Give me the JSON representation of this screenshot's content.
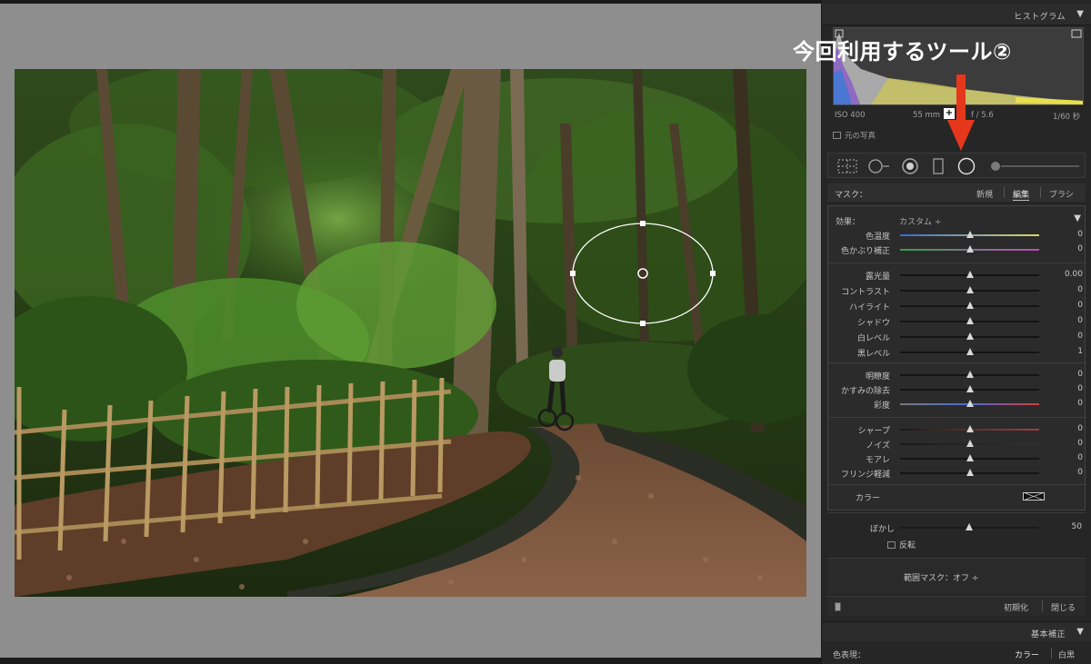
{
  "annotation": {
    "label": "今回利用するツール②",
    "arrow_color": "#e5371c"
  },
  "histogram_panel": {
    "title": "ヒストグラム",
    "iso": "ISO 400",
    "focal": "55 mm",
    "aperture": "f / 5.6",
    "shutter": "1/60 秒",
    "original_photo": "元の写真"
  },
  "tools": [
    "crop-overlay-icon",
    "spot-removal-icon",
    "red-eye-icon",
    "graduated-filter-icon",
    "radial-filter-icon",
    "adjustment-brush-icon"
  ],
  "mask": {
    "label": "マスク：",
    "options": [
      "新規",
      "編集",
      "ブラシ"
    ]
  },
  "effect": {
    "label": "効果：",
    "preset": "カスタム ÷"
  },
  "sliders_wb": [
    {
      "label": "色温度",
      "value": "0",
      "pos": 0.5
    },
    {
      "label": "色かぶり補正",
      "value": "0",
      "pos": 0.5
    }
  ],
  "sliders_tone": [
    {
      "label": "露光量",
      "value": "0.00",
      "pos": 0.5
    },
    {
      "label": "コントラスト",
      "value": "0",
      "pos": 0.5
    },
    {
      "label": "ハイライト",
      "value": "0",
      "pos": 0.5
    },
    {
      "label": "シャドウ",
      "value": "0",
      "pos": 0.5
    },
    {
      "label": "白レベル",
      "value": "0",
      "pos": 0.5
    },
    {
      "label": "黒レベル",
      "value": "1",
      "pos": 0.5
    }
  ],
  "sliders_presence": [
    {
      "label": "明瞭度",
      "value": "0",
      "pos": 0.5
    },
    {
      "label": "かすみの除去",
      "value": "0",
      "pos": 0.5
    },
    {
      "label": "彩度",
      "value": "0",
      "pos": 0.5
    }
  ],
  "sliders_detail": [
    {
      "label": "シャープ",
      "value": "0",
      "pos": 0.5
    },
    {
      "label": "ノイズ",
      "value": "0",
      "pos": 0.5
    },
    {
      "label": "モアレ",
      "value": "0",
      "pos": 0.5
    },
    {
      "label": "フリンジ軽減",
      "value": "0",
      "pos": 0.5
    }
  ],
  "color": {
    "label": "カラー"
  },
  "blur": {
    "label": "ぼかし",
    "value": "50",
    "pos": 0.5
  },
  "invert": {
    "label": "反転"
  },
  "range_mask": {
    "label": "範囲マスク：オフ ÷"
  },
  "footer": {
    "reset": "初期化",
    "close": "閉じる"
  },
  "basic": {
    "title": "基本補正"
  },
  "profile": {
    "label": "色表現：",
    "color": "カラー",
    "bw": "白黒"
  }
}
